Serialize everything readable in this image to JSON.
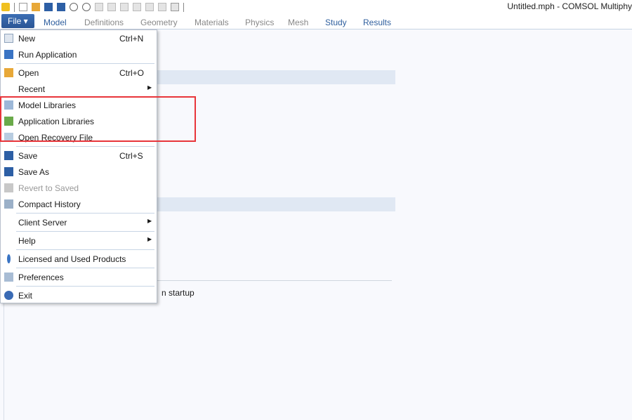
{
  "window": {
    "title": "Untitled.mph - COMSOL Multiphy"
  },
  "toolbar": {
    "icons": [
      "new-icon",
      "open-icon",
      "save-icon",
      "save-as-icon",
      "undo-icon",
      "redo-icon",
      "copy-icon",
      "paste-icon",
      "duplicate-icon",
      "delete-icon",
      "select-icon",
      "disable-icon",
      "more-icon"
    ]
  },
  "ribbon": {
    "file_label": "File ▾",
    "tabs": [
      {
        "label": "Model",
        "active": true
      },
      {
        "label": "Definitions"
      },
      {
        "label": "Geometry"
      },
      {
        "label": "Materials"
      },
      {
        "label": "Physics"
      },
      {
        "label": "Mesh"
      },
      {
        "label": "Study",
        "active": true
      },
      {
        "label": "Results",
        "active": true
      }
    ]
  },
  "background": {
    "startup_text": "n startup"
  },
  "menu": {
    "items": [
      {
        "label": "New",
        "shortcut": "Ctrl+N",
        "icon": "new-file-icon",
        "color": "#dfe6ef"
      },
      {
        "label": "Run Application",
        "icon": "run-application-icon",
        "color": "#3a74c4"
      },
      {
        "sep": true
      },
      {
        "label": "Open",
        "shortcut": "Ctrl+O",
        "icon": "folder-open-icon",
        "color": "#e8a838"
      },
      {
        "label": "Recent",
        "submenu": true
      },
      {
        "label": "Model Libraries",
        "icon": "model-libraries-icon",
        "color": "#9db8d8"
      },
      {
        "label": "Application Libraries",
        "icon": "application-libraries-icon",
        "color": "#6aaa4a"
      },
      {
        "label": "Open Recovery File",
        "icon": "recovery-file-icon",
        "color": "#b8cce0"
      },
      {
        "sep": true
      },
      {
        "label": "Save",
        "shortcut": "Ctrl+S",
        "icon": "save-icon",
        "color": "#2d5fa5"
      },
      {
        "label": "Save As",
        "icon": "save-as-icon",
        "color": "#2d5fa5"
      },
      {
        "label": "Revert to Saved",
        "icon": "revert-icon",
        "color": "#c8c8c8",
        "disabled": true
      },
      {
        "label": "Compact History",
        "icon": "compact-history-icon",
        "color": "#9bb0c8"
      },
      {
        "sep": true
      },
      {
        "label": "Client Server",
        "submenu": true
      },
      {
        "sep": true
      },
      {
        "label": "Help",
        "submenu": true
      },
      {
        "sep": true
      },
      {
        "label": "Licensed and Used Products",
        "icon": "key-icon",
        "color": "#3a74c4"
      },
      {
        "sep": true
      },
      {
        "label": "Preferences",
        "icon": "preferences-icon",
        "color": "#a8bcd4"
      },
      {
        "sep": true
      },
      {
        "label": "Exit",
        "icon": "exit-icon",
        "color": "#3a6bb5"
      }
    ]
  }
}
